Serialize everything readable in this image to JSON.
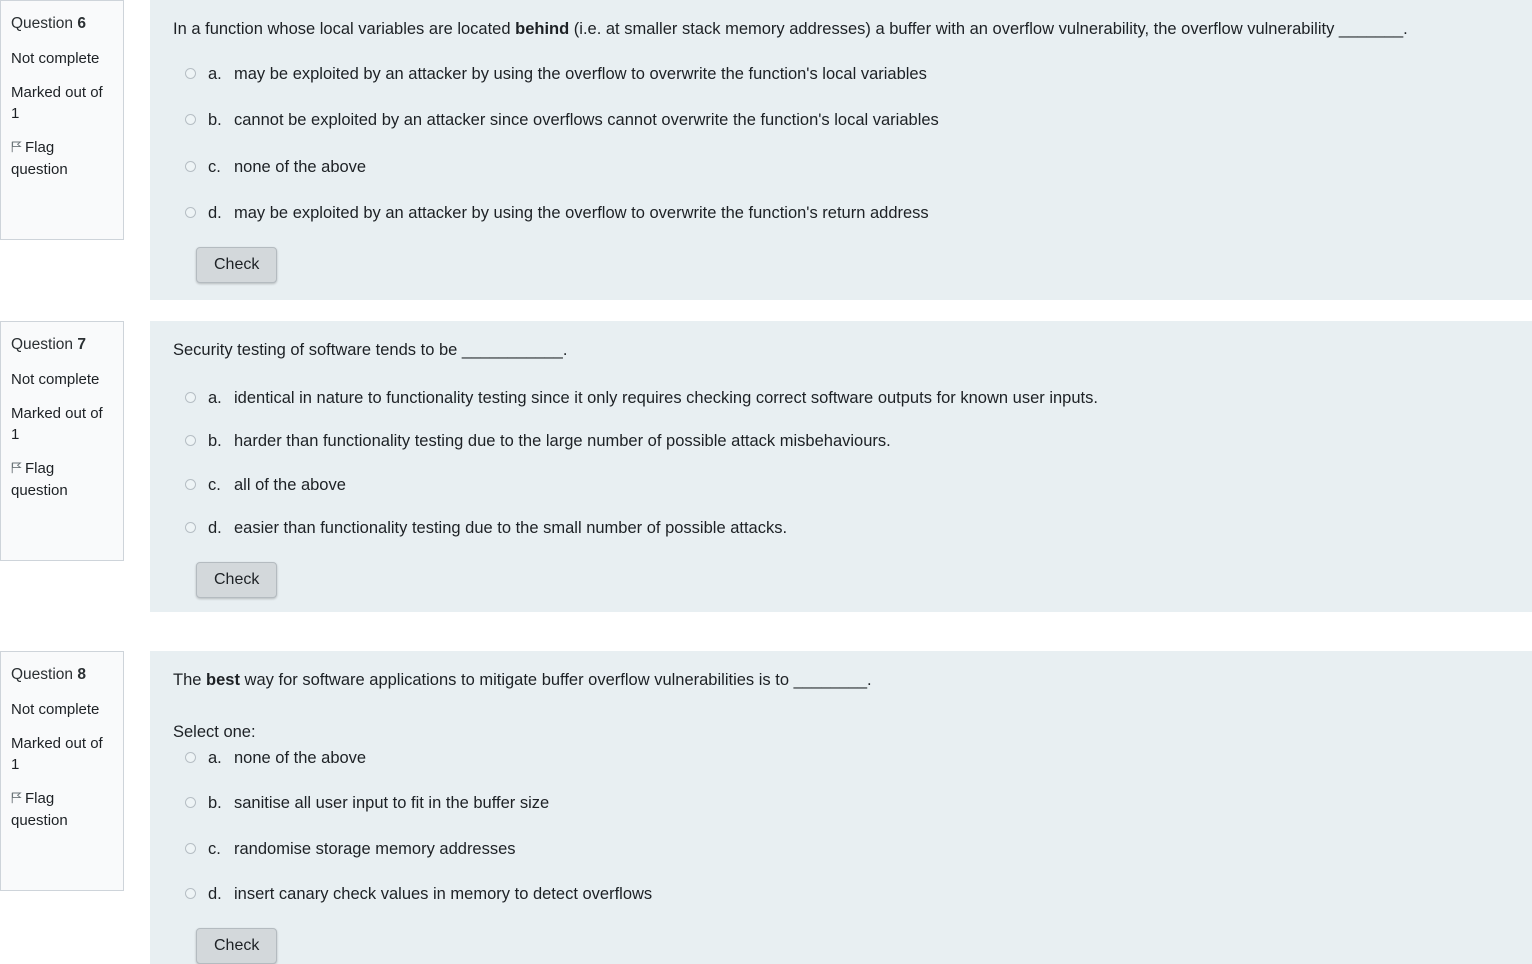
{
  "theme": {
    "content_bg": "#e8eff2",
    "sidebar_bg": "#f9fafb",
    "sidebar_border": "#ced4da",
    "button_bg": "#d3d8db",
    "text_color": "#1d2125"
  },
  "questions": [
    {
      "info": {
        "number_label": "Question",
        "number": "6",
        "state": "Not complete",
        "grade": "Marked out of 1",
        "flag_label": "Flag question",
        "flag_icon": "flag-icon"
      },
      "stem_pre": "In a function whose local variables are located ",
      "stem_bold": "behind",
      "stem_post": " (i.e. at smaller stack memory addresses) a buffer with an overflow vulnerability, the overflow vulnerability _______.",
      "select_one": "",
      "options": [
        {
          "key": "a.",
          "text": "may be exploited by an attacker by using the overflow to overwrite the function's local variables"
        },
        {
          "key": "b.",
          "text": "cannot be exploited by an attacker since overflows cannot overwrite the function's local variables"
        },
        {
          "key": "c.",
          "text": "none of the above"
        },
        {
          "key": "d.",
          "text": "may be exploited by an attacker by using the overflow to overwrite the function's return address"
        }
      ],
      "check_label": "Check"
    },
    {
      "info": {
        "number_label": "Question",
        "number": "7",
        "state": "Not complete",
        "grade": "Marked out of 1",
        "flag_label": "Flag question",
        "flag_icon": "flag-icon"
      },
      "stem_pre": "Security testing of software tends to be ___________.",
      "stem_bold": "",
      "stem_post": "",
      "select_one": "",
      "options": [
        {
          "key": "a.",
          "text": "identical in nature to functionality testing since it only requires checking correct software outputs for known user inputs."
        },
        {
          "key": "b.",
          "text": "harder than functionality testing due to the large number of possible attack misbehaviours."
        },
        {
          "key": "c.",
          "text": "all of the above"
        },
        {
          "key": "d.",
          "text": "easier than functionality testing due to the small number of possible attacks."
        }
      ],
      "check_label": "Check"
    },
    {
      "info": {
        "number_label": "Question",
        "number": "8",
        "state": "Not complete",
        "grade": "Marked out of 1",
        "flag_label": "Flag question",
        "flag_icon": "flag-icon"
      },
      "stem_pre": "The ",
      "stem_bold": "best",
      "stem_post": " way for software applications to mitigate buffer overflow vulnerabilities is to ________.",
      "select_one": "Select one:",
      "options": [
        {
          "key": "a.",
          "text": "none of the above"
        },
        {
          "key": "b.",
          "text": "sanitise all user input to fit in the buffer size"
        },
        {
          "key": "c.",
          "text": "randomise storage memory addresses"
        },
        {
          "key": "d.",
          "text": "insert canary check values in memory to detect overflows"
        }
      ],
      "check_label": "Check"
    }
  ]
}
